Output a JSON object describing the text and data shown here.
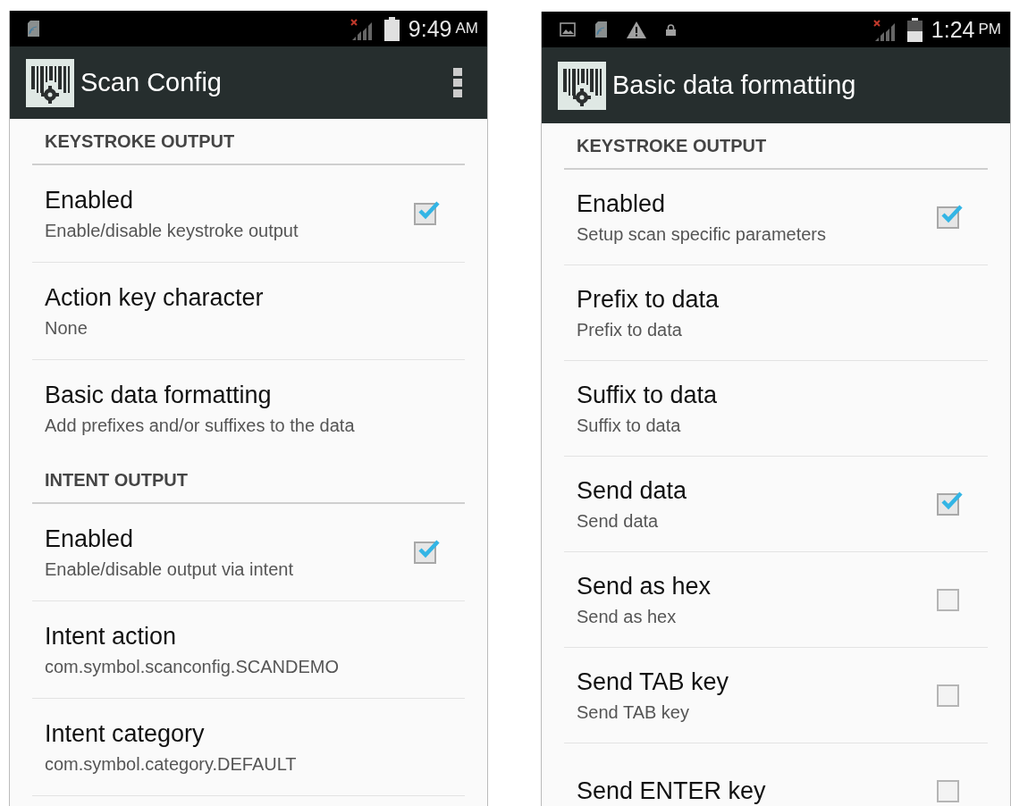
{
  "screens": [
    {
      "status_bar": {
        "notifications": [
          {
            "kind": "sdcard"
          }
        ],
        "battery": {
          "kind": "full"
        },
        "time": "9:49",
        "meridiem": "AM"
      },
      "app_bar": {
        "title": "Scan Config",
        "overflow_menu": true
      },
      "sections": [
        {
          "header": "KEYSTROKE OUTPUT",
          "items": [
            {
              "kind": "check",
              "title": "Enabled",
              "summary": "Enable/disable keystroke output",
              "checked": true
            },
            {
              "kind": "plain",
              "title": "Action key character",
              "summary": "None"
            },
            {
              "kind": "plain",
              "title": "Basic data formatting",
              "summary": "Add prefixes and/or suffixes to the data"
            }
          ]
        },
        {
          "header": "INTENT OUTPUT",
          "items": [
            {
              "kind": "check",
              "title": "Enabled",
              "summary": "Enable/disable output via intent",
              "checked": true
            },
            {
              "kind": "plain",
              "title": "Intent action",
              "summary": "com.symbol.scanconfig.SCANDEMO"
            },
            {
              "kind": "plain",
              "title": "Intent category",
              "summary": "com.symbol.category.DEFAULT"
            }
          ]
        }
      ]
    },
    {
      "status_bar": {
        "notifications": [
          {
            "kind": "image"
          },
          {
            "kind": "sdcard"
          },
          {
            "kind": "warning"
          },
          {
            "kind": "lock"
          }
        ],
        "battery": {
          "kind": "half"
        },
        "time": "1:24",
        "meridiem": "PM"
      },
      "app_bar": {
        "title": "Basic data formatting",
        "overflow_menu": false
      },
      "sections": [
        {
          "header": "KEYSTROKE OUTPUT",
          "items": [
            {
              "kind": "check",
              "title": "Enabled",
              "summary": "Setup scan specific parameters",
              "checked": true
            },
            {
              "kind": "plain",
              "title": "Prefix to data",
              "summary": "Prefix to data"
            },
            {
              "kind": "plain",
              "title": "Suffix to data",
              "summary": "Suffix to data"
            },
            {
              "kind": "check",
              "title": "Send data",
              "summary": "Send data",
              "checked": true
            },
            {
              "kind": "check",
              "title": "Send as hex",
              "summary": "Send as hex",
              "checked": false
            },
            {
              "kind": "check",
              "title": "Send TAB key",
              "summary": "Send TAB key",
              "checked": false
            },
            {
              "kind": "check",
              "title": "Send ENTER key",
              "checked": false
            }
          ]
        }
      ]
    }
  ]
}
